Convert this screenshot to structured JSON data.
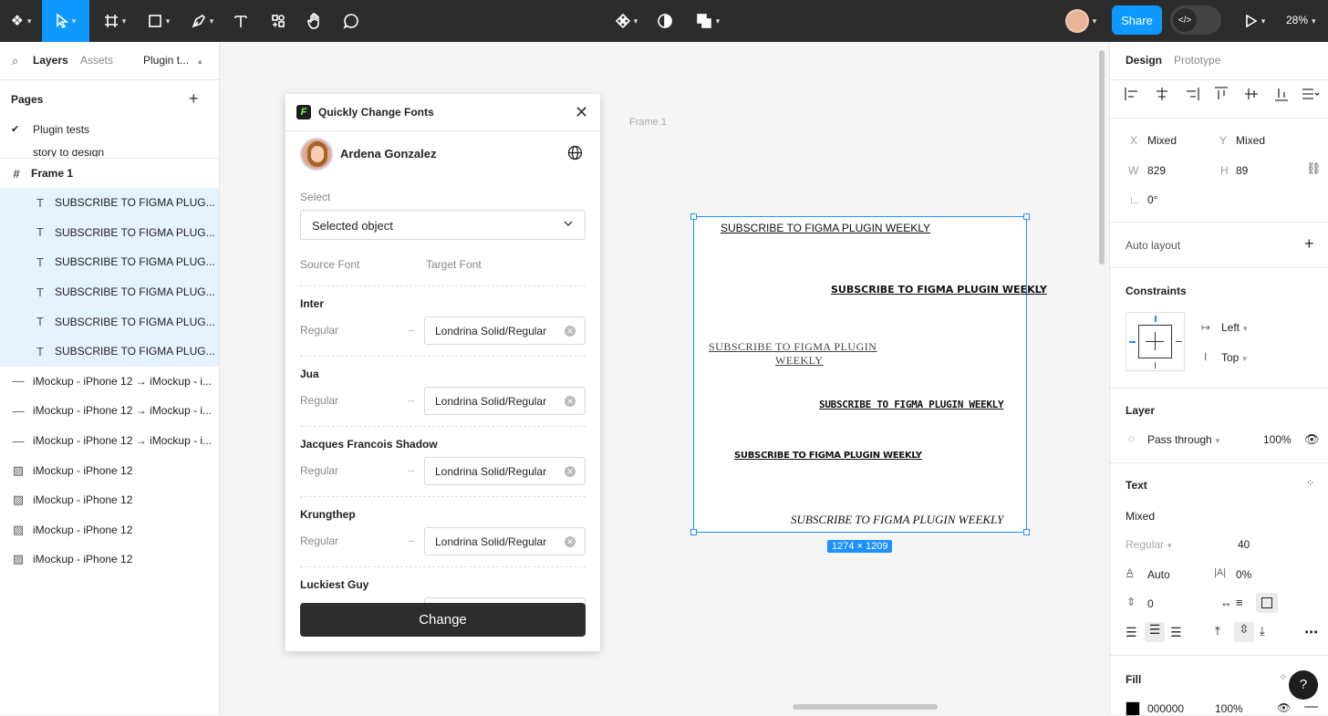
{
  "toolbar": {
    "share_label": "Share",
    "zoom": "28%"
  },
  "left_panel": {
    "tabs": [
      "Layers",
      "Assets",
      "Plugin t..."
    ],
    "pages_title": "Pages",
    "pages": [
      "Plugin tests",
      "story to design"
    ],
    "frame_name": "Frame 1",
    "layers": [
      {
        "name": "SUBSCRIBE TO FIGMA PLUG...",
        "icon": "text-icon",
        "selected": true
      },
      {
        "name": "SUBSCRIBE TO FIGMA PLUG...",
        "icon": "text-icon",
        "selected": true
      },
      {
        "name": "SUBSCRIBE TO FIGMA PLUG...",
        "icon": "text-icon",
        "selected": true
      },
      {
        "name": "SUBSCRIBE TO FIGMA PLUG...",
        "icon": "text-icon",
        "selected": true
      },
      {
        "name": "SUBSCRIBE TO FIGMA PLUG...",
        "icon": "text-icon",
        "selected": true
      },
      {
        "name": "SUBSCRIBE TO FIGMA PLUG...",
        "icon": "text-icon",
        "selected": true
      },
      {
        "name": "iMockup - iPhone 12 → iMockup - i...",
        "icon": "line-icon",
        "selected": false
      },
      {
        "name": "iMockup - iPhone 12 → iMockup - i...",
        "icon": "line-icon",
        "selected": false
      },
      {
        "name": "iMockup - iPhone 12 → iMockup - i...",
        "icon": "line-icon",
        "selected": false
      },
      {
        "name": "iMockup - iPhone 12",
        "icon": "image-icon",
        "selected": false
      },
      {
        "name": "iMockup - iPhone 12",
        "icon": "image-icon",
        "selected": false
      },
      {
        "name": "iMockup - iPhone 12",
        "icon": "image-icon",
        "selected": false
      },
      {
        "name": "iMockup - iPhone 12",
        "icon": "image-icon",
        "selected": false
      }
    ]
  },
  "canvas": {
    "frame_label": "Frame 1",
    "dimension_badge": "1274 × 1209",
    "texts": [
      "SUBSCRIBE TO FIGMA PLUGIN WEEKLY",
      "SUBSCRIBE TO FIGMA PLUGIN WEEKLY",
      "SUBSCRIBE TO FIGMA PLUGIN",
      "WEEKLY",
      "SUBSCRIBE TO FIGMA PLUGIN WEEKLY",
      "SUBSCRIBE TO FIGMA PLUGIN WEEKLY",
      "SUBSCRIBE TO FIGMA PLUGIN WEEKLY"
    ]
  },
  "plugin": {
    "title": "Quickly Change Fonts",
    "user_name": "Ardena Gonzalez",
    "select_label": "Select",
    "select_value": "Selected object",
    "source_header": "Source Font",
    "target_header": "Target Font",
    "fonts": [
      {
        "source": "Inter",
        "style": "Regular",
        "target": "Londrina Solid/Regular"
      },
      {
        "source": "Jua",
        "style": "Regular",
        "target": "Londrina Solid/Regular"
      },
      {
        "source": "Jacques Francois Shadow",
        "style": "Regular",
        "target": "Londrina Solid/Regular"
      },
      {
        "source": "Krungthep",
        "style": "Regular",
        "target": "Londrina Solid/Regular"
      },
      {
        "source": "Luckiest Guy",
        "style": "",
        "target": ""
      }
    ],
    "change_label": "Change"
  },
  "right_panel": {
    "tabs": [
      "Design",
      "Prototype"
    ],
    "x_label": "X",
    "x_value": "Mixed",
    "y_label": "Y",
    "y_value": "Mixed",
    "w_label": "W",
    "w_value": "829",
    "h_label": "H",
    "h_value": "89",
    "rotation": "0°",
    "auto_layout": "Auto layout",
    "constraints_title": "Constraints",
    "constraint_h": "Left",
    "constraint_v": "Top",
    "layer_title": "Layer",
    "blend": "Pass through",
    "opacity": "100%",
    "text_title": "Text",
    "font_family": "Mixed",
    "font_weight": "Regular",
    "font_size": "40",
    "line_height": "Auto",
    "letter_spacing": "0%",
    "paragraph_spacing": "0",
    "fill_title": "Fill",
    "fill_hex": "000000",
    "fill_opacity": "100%",
    "fill_color": "#000000"
  },
  "colors": {
    "accent": "#0d99ff",
    "selection": "#1e90ff",
    "selected_row": "#e5f2ff",
    "toolbar_bg": "#2c2c2c"
  }
}
